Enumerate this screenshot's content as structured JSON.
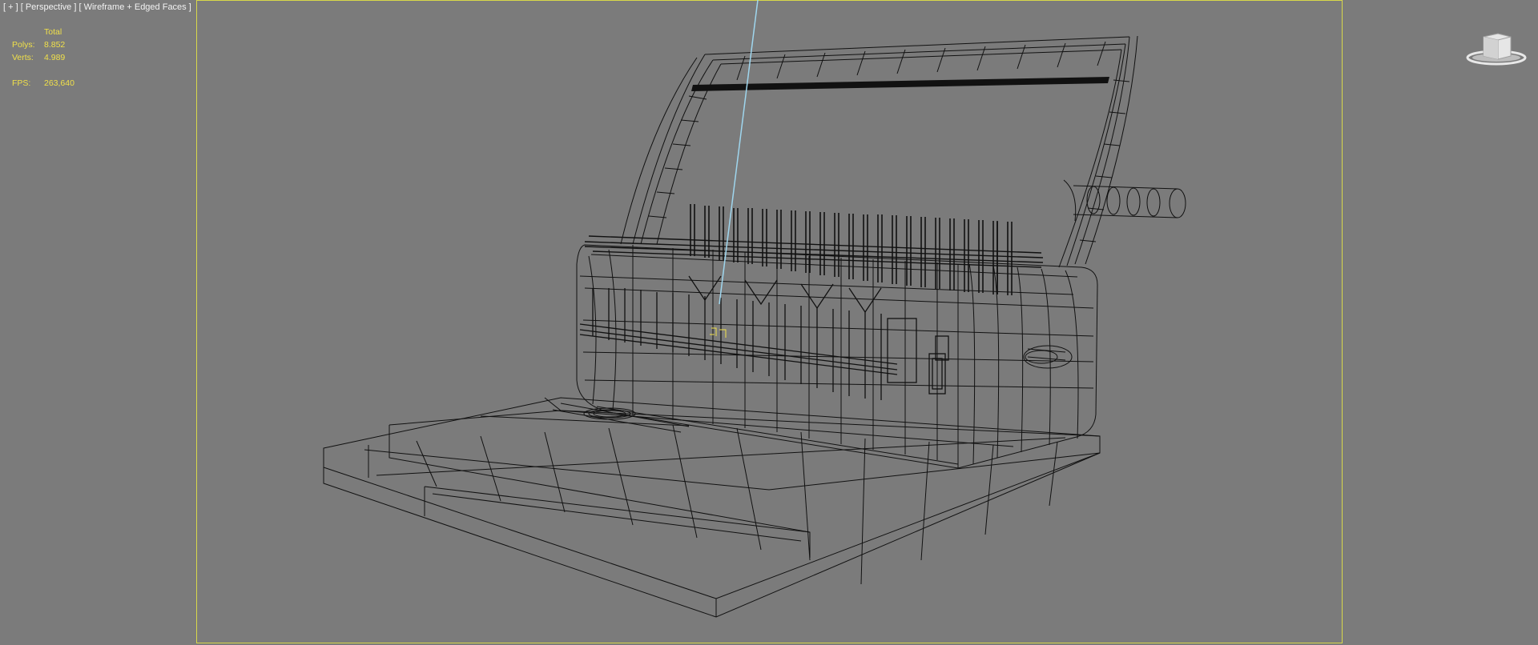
{
  "viewport": {
    "label_plus": "[ + ]",
    "label_view": "[ Perspective ]",
    "label_shading": "[ Wireframe + Edged Faces ]"
  },
  "stats": {
    "total_label": "Total",
    "polys_label": "Polys:",
    "polys_value": "8.852",
    "verts_label": "Verts:",
    "verts_value": "4.989",
    "fps_label": "FPS:",
    "fps_value": "263,640"
  },
  "colors": {
    "background": "#7b7b7b",
    "safe_frame": "#d8d84a",
    "stats_text": "#f0e04a",
    "wire": "#111111",
    "axis_line": "#9fd6ee"
  },
  "icons": {
    "viewcube": "viewcube-icon",
    "pivot": "pivot-gizmo-icon"
  }
}
